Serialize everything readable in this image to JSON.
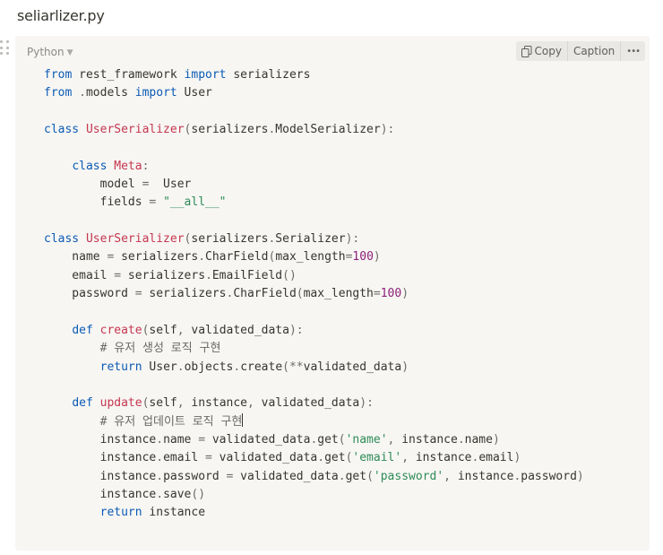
{
  "page": {
    "title": "seliarlizer.py"
  },
  "code_block": {
    "language": "Python",
    "toolbar": {
      "copy_label": "Copy",
      "caption_label": "Caption",
      "more_label": "•••"
    },
    "lines": [
      "from rest_framework import serializers",
      "from .models import User",
      "",
      "class UserSerializer(serializers.ModelSerializer):",
      "",
      "    class Meta:",
      "        model =  User",
      "        fields = \"__all__\"",
      "",
      "class UserSerializer(serializers.Serializer):",
      "    name = serializers.CharField(max_length=100)",
      "    email = serializers.EmailField()",
      "    password = serializers.CharField(max_length=100)",
      "",
      "    def create(self, validated_data):",
      "        # 유저 생성 로직 구현",
      "        return User.objects.create(**validated_data)",
      "",
      "    def update(self, instance, validated_data):",
      "        # 유저 업데이트 로직 구현",
      "        instance.name = validated_data.get('name', instance.name)",
      "        instance.email = validated_data.get('email', instance.email)",
      "        instance.password = validated_data.get('password', instance.password)",
      "        instance.save()",
      "        return instance"
    ]
  },
  "icons": {
    "drag": "drag-handle-icon",
    "copy": "copy-icon",
    "chevron": "chevron-down-icon"
  },
  "colors": {
    "background": "#f7f6f3",
    "keyword": "#0c5bb5",
    "function": "#c5364f",
    "string": "#2e8b57",
    "number": "#8c1f7a"
  }
}
